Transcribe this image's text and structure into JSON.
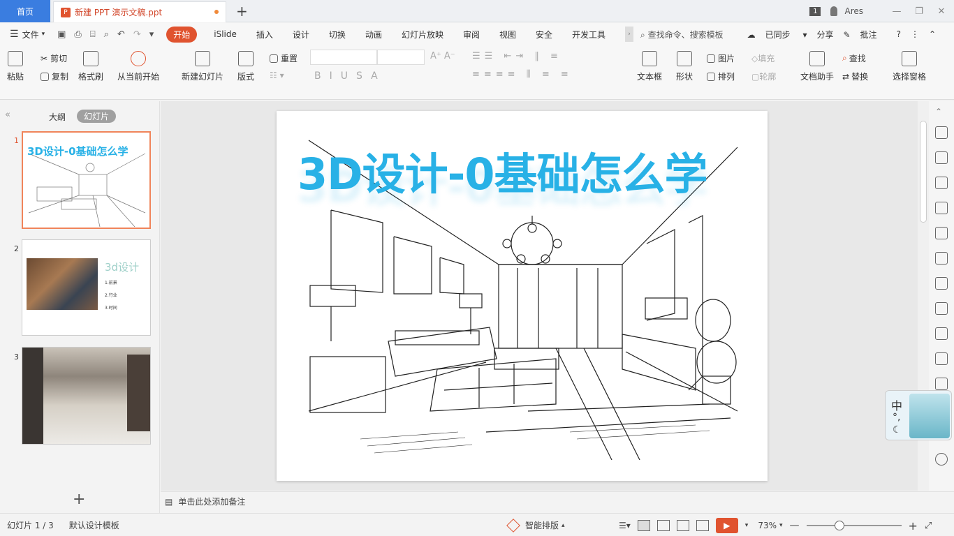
{
  "titlebar": {
    "home_tab": "首页",
    "doc_tab": "新建 PPT 演示文稿.ppt",
    "badge": "1",
    "user": "Ares"
  },
  "menu": {
    "file": "文件",
    "tabs": [
      "开始",
      "iSlide",
      "插入",
      "设计",
      "切换",
      "动画",
      "幻灯片放映",
      "审阅",
      "视图",
      "安全",
      "开发工具"
    ],
    "search": "查找命令、搜索模板",
    "sync": "已同步",
    "share": "分享",
    "comment": "批注"
  },
  "ribbon": {
    "paste": "粘贴",
    "cut": "剪切",
    "copy": "复制",
    "format_brush": "格式刷",
    "from_start": "从当前开始",
    "new_slide": "新建幻灯片",
    "layout": "版式",
    "reset": "重置",
    "text_box": "文本框",
    "shape": "形状",
    "picture": "图片",
    "fill": "填充",
    "arrange": "排列",
    "outline": "轮廓",
    "doc_helper": "文档助手",
    "find": "查找",
    "replace": "替换",
    "select_pane": "选择窗格"
  },
  "left_panel": {
    "outline_tab": "大纲",
    "slides_tab": "幻灯片",
    "thumb2_title": "3d设计",
    "thumb2_items": [
      "1.前景",
      "2.行业",
      "3.时间"
    ]
  },
  "slide": {
    "title": "3D设计-0基础怎么学"
  },
  "ime": {
    "lang": "中"
  },
  "notes": {
    "placeholder": "单击此处添加备注"
  },
  "status": {
    "slide_count": "幻灯片 1 / 3",
    "template": "默认设计模板",
    "smart_layout": "智能排版",
    "zoom": "73%"
  }
}
